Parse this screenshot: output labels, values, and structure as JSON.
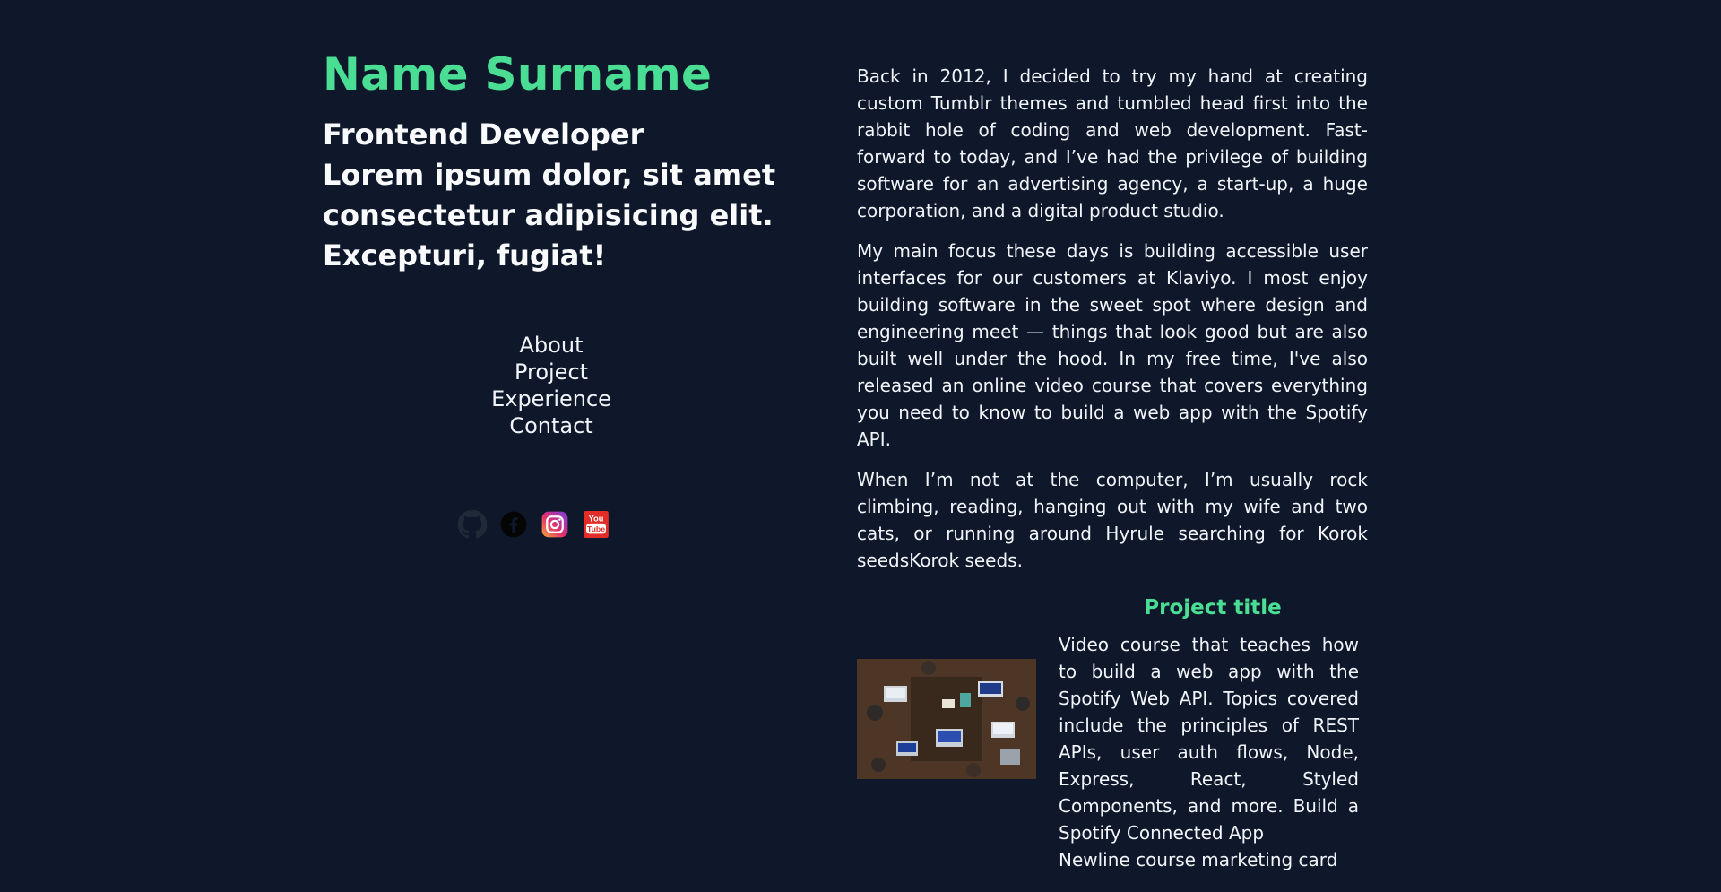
{
  "header": {
    "name": "Name Surname",
    "tagline": [
      "Frontend Developer",
      "Lorem ipsum dolor, sit amet",
      "consectetur adipisicing elit.",
      "Excepturi, fugiat!"
    ]
  },
  "nav": {
    "items": [
      {
        "label": "About"
      },
      {
        "label": "Project"
      },
      {
        "label": "Experience"
      },
      {
        "label": "Contact"
      }
    ]
  },
  "socials": [
    {
      "icon": "github-icon"
    },
    {
      "icon": "facebook-icon"
    },
    {
      "icon": "instagram-icon"
    },
    {
      "icon": "youtube-icon"
    }
  ],
  "about": {
    "paragraphs": [
      "Back in 2012, I decided to try my hand at creating custom Tumblr themes and tumbled head first into the rabbit hole of coding and web development. Fast-forward to today, and I’ve had the privilege of building software for an advertising agency, a start-up, a huge corporation, and a digital product studio.",
      "My main focus these days is building accessible user interfaces for our customers at Klaviyo. I most enjoy building software in the sweet spot where design and engineering meet — things that look good but are also built well under the hood. In my free time, I've also released an online video course that covers everything you need to know to build a web app with the Spotify API.",
      "When I’m not at the computer, I’m usually rock climbing, reading, hanging out with my wife and two cats, or running around Hyrule searching for Korok seedsKorok seeds."
    ]
  },
  "project": {
    "title": "Project title",
    "description": "Video course that teaches how to build a web app with the Spotify Web API. Topics covered include the principles of REST APIs, user auth flows, Node, Express, React, Styled Components, and more. Build a Spotify Connected App",
    "caption": "Newline course marketing card"
  },
  "colors": {
    "background": "#0f172a",
    "accent": "#4ade94",
    "text": "#f1f5f9"
  }
}
